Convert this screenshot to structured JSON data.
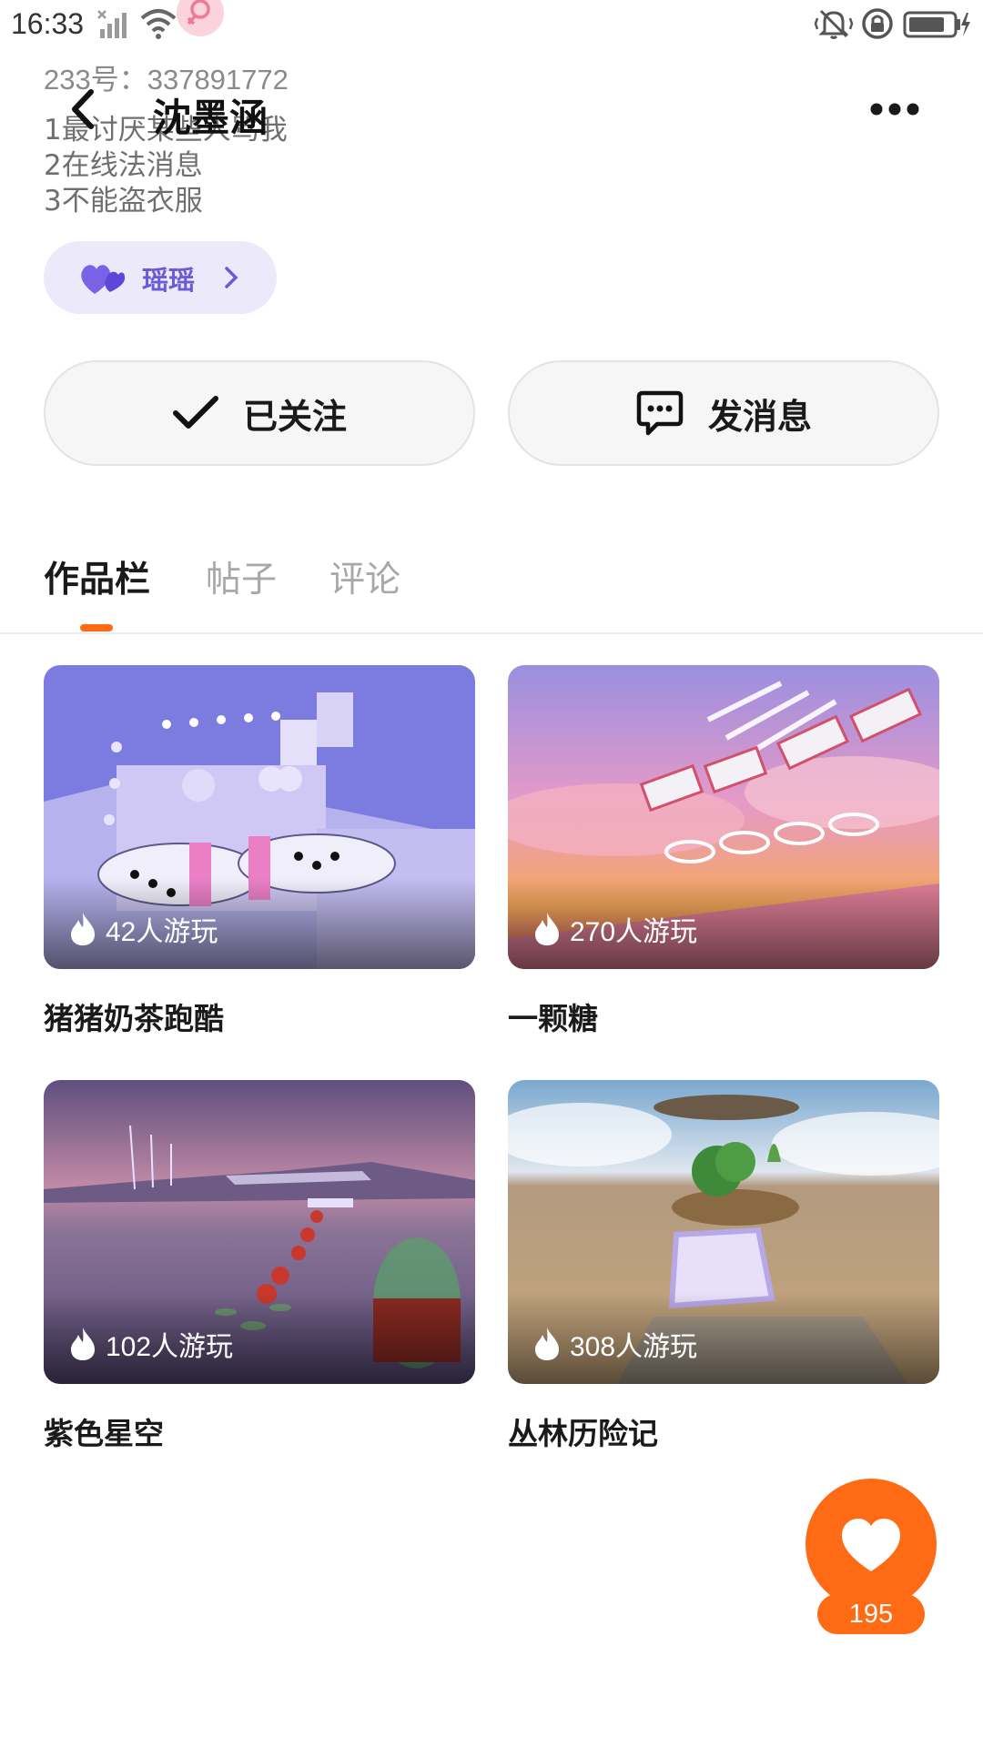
{
  "status_bar": {
    "time": "16:33",
    "icons": [
      "no-signal-icon",
      "wifi-icon",
      "female-icon",
      "vibrate-icon",
      "rotation-lock-icon",
      "battery-icon"
    ]
  },
  "profile": {
    "id_line": "233号：337891772",
    "name": "沈墨涵",
    "bio_lines": [
      "1最讨厌某些人骂我",
      "2在线法消息",
      "3不能盗衣服"
    ],
    "tag": {
      "icon": "double-heart-icon",
      "label": "瑶瑶"
    }
  },
  "actions": {
    "follow_label": "已关注",
    "message_label": "发消息"
  },
  "tabs": [
    {
      "label": "作品栏",
      "active": true
    },
    {
      "label": "帖子",
      "active": false
    },
    {
      "label": "评论",
      "active": false
    }
  ],
  "works": [
    {
      "plays": "42人游玩",
      "title": "猪猪奶茶跑酷"
    },
    {
      "plays": "270人游玩",
      "title": "一颗糖"
    },
    {
      "plays": "102人游玩",
      "title": "紫色星空"
    },
    {
      "plays": "308人游玩",
      "title": "丛林历险记"
    }
  ],
  "like": {
    "icon": "heart-icon",
    "count": "195"
  },
  "colors": {
    "accent": "#ff6a14",
    "tag_text": "#6b5bd6",
    "tag_bg": "#ece9fb"
  }
}
